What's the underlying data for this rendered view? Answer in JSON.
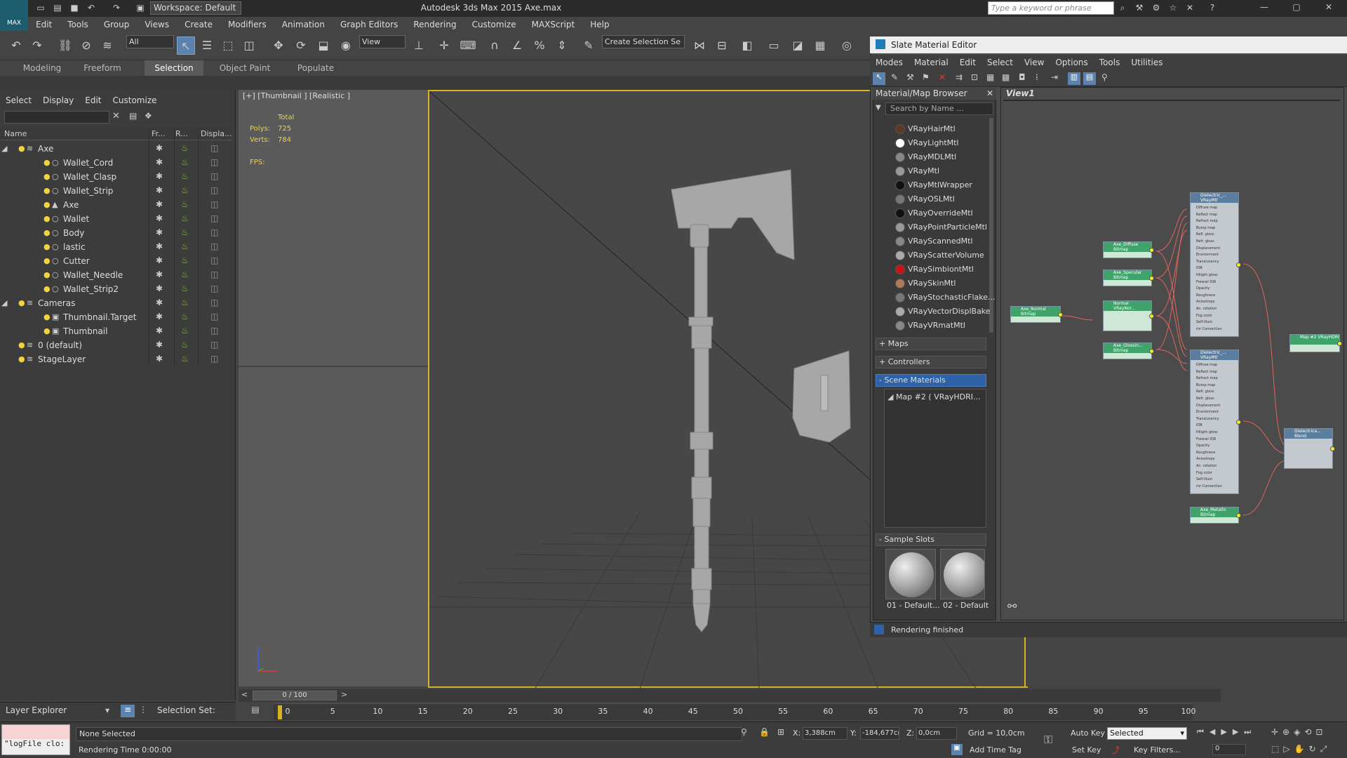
{
  "app": {
    "title": "Autodesk 3ds Max  2015     Axe.max",
    "workspace": "Workspace: Default",
    "search_placeholder": "Type a keyword or phrase",
    "logo_text": "MAX"
  },
  "menu": [
    "Edit",
    "Tools",
    "Group",
    "Views",
    "Create",
    "Modifiers",
    "Animation",
    "Graph Editors",
    "Rendering",
    "Customize",
    "MAXScript",
    "Help"
  ],
  "toolbar": {
    "filter": "All",
    "ref_coord": "View",
    "selection_set": "Create Selection Se"
  },
  "ribbon_tabs": [
    "Modeling",
    "Freeform",
    "Selection",
    "Object Paint",
    "Populate"
  ],
  "ribbon_active": "Selection",
  "scene_explorer": {
    "menu": [
      "Select",
      "Display",
      "Edit",
      "Customize"
    ],
    "columns": [
      "Name",
      "Fr...",
      "R...",
      "Displa..."
    ],
    "rows": [
      {
        "name": "Axe",
        "indent": 0,
        "type": "layer",
        "expand": true
      },
      {
        "name": "Wallet_Cord",
        "indent": 1,
        "type": "object"
      },
      {
        "name": "Wallet_Clasp",
        "indent": 1,
        "type": "object"
      },
      {
        "name": "Wallet_Strip",
        "indent": 1,
        "type": "object"
      },
      {
        "name": "Axe",
        "indent": 1,
        "type": "object2"
      },
      {
        "name": "Wallet",
        "indent": 1,
        "type": "object"
      },
      {
        "name": "Body",
        "indent": 1,
        "type": "object"
      },
      {
        "name": "lastic",
        "indent": 1,
        "type": "object"
      },
      {
        "name": "Cutter",
        "indent": 1,
        "type": "object"
      },
      {
        "name": "Wallet_Needle",
        "indent": 1,
        "type": "object"
      },
      {
        "name": "Wallet_Strip2",
        "indent": 1,
        "type": "object"
      },
      {
        "name": "Cameras",
        "indent": 0,
        "type": "layer",
        "expand": true
      },
      {
        "name": "Thumbnail.Target",
        "indent": 1,
        "type": "camera"
      },
      {
        "name": "Thumbnail",
        "indent": 1,
        "type": "camera"
      },
      {
        "name": "0 (default)",
        "indent": 0,
        "type": "layer"
      },
      {
        "name": "StageLayer",
        "indent": 0,
        "type": "layer"
      }
    ],
    "footer_label": "Layer Explorer",
    "selection_set_label": "Selection Set:"
  },
  "viewport": {
    "label": "[+] [Thumbnail ] [Realistic ]",
    "stats_total": "Total",
    "polys_label": "Polys:",
    "polys": "725",
    "verts_label": "Verts:",
    "verts": "784",
    "fps_label": "FPS:"
  },
  "timeline": {
    "frame": "0 / 100",
    "ticks": [
      "0",
      "5",
      "10",
      "15",
      "20",
      "25",
      "30",
      "35",
      "40",
      "45",
      "50",
      "55",
      "60",
      "65",
      "70",
      "75",
      "80",
      "85",
      "90",
      "95",
      "100"
    ]
  },
  "status": {
    "script_text": "\"logFile clo:",
    "selection": "None Selected",
    "rendering_time": "Rendering Time  0:00:00",
    "x_label": "X:",
    "x": "3,388cm",
    "y_label": "Y:",
    "y": "-184,677cr",
    "z_label": "Z:",
    "z": "0,0cm",
    "grid": "Grid = 10,0cm",
    "add_time_tag": "Add Time Tag",
    "auto_key": "Auto Key",
    "set_key": "Set Key",
    "key_mode": "Selected",
    "key_filters": "Key Filters...",
    "frame_field": "0"
  },
  "slate": {
    "title": "Slate Material Editor",
    "menu": [
      "Modes",
      "Material",
      "Edit",
      "Select",
      "View",
      "Options",
      "Tools",
      "Utilities"
    ],
    "browser_title": "Material/Map Browser",
    "browser_search": "Search by Name ...",
    "materials": [
      {
        "name": "VRayHairMtl",
        "color": "#5a3a22"
      },
      {
        "name": "VRayLightMtl",
        "color": "#ffffff"
      },
      {
        "name": "VRayMDLMtl",
        "color": "#888888"
      },
      {
        "name": "VRayMtl",
        "color": "#999999"
      },
      {
        "name": "VRayMtlWrapper",
        "color": "#111111"
      },
      {
        "name": "VRayOSLMtl",
        "color": "#777777"
      },
      {
        "name": "VRayOverrideMtl",
        "color": "#111111"
      },
      {
        "name": "VRayPointParticleMtl",
        "color": "#999999"
      },
      {
        "name": "VRayScannedMtl",
        "color": "#888888"
      },
      {
        "name": "VRayScatterVolume",
        "color": "#aaaaaa"
      },
      {
        "name": "VRaySimbiontMtl",
        "color": "#cc1111"
      },
      {
        "name": "VRaySkinMtl",
        "color": "#b07a5a"
      },
      {
        "name": "VRayStochasticFlake...",
        "color": "#777777"
      },
      {
        "name": "VRayVectorDisplBake",
        "color": "#aaaaaa"
      },
      {
        "name": "VRayVRmatMtl",
        "color": "#888888"
      }
    ],
    "sections": {
      "maps": "+ Maps",
      "controllers": "+ Controllers",
      "scene_materials": "- Scene Materials",
      "scene_item": "Map #2  ( VRayHDRI...",
      "sample_slots": "- Sample Slots"
    },
    "slots": [
      "01 - Default...",
      "02 - Default"
    ],
    "view_tab": "View1",
    "status": "Rendering finished",
    "nodes": {
      "dielectric_1": "Dielectric_... VRayMtl",
      "dielectric_2": "Dielectric_... VRayMtl",
      "blend": "Dielectrica... Blend",
      "diffuse": "Axe_Diffuse Bitmap",
      "specular": "Axe_Specular Bitmap",
      "normal": "Normal VRayNor...",
      "glossiness": "Axe_Glossin... Bitmap",
      "normal_map": "Axe_Normal Bitmap",
      "metallic": "Axe_Metallic Bitmap",
      "hdri": "Map #2 VRayHDRI"
    },
    "vray_slots": [
      "Diffuse map",
      "Reflect map",
      "Refract map",
      "Bump map",
      "Refl. gloss",
      "Refr. gloss",
      "Displacement",
      "Environment",
      "Translucency",
      "IOR",
      "Hilight gloss",
      "Fresnel IOR",
      "Opacity",
      "Roughness",
      "Anisotropy",
      "An. rotation",
      "Fog color",
      "Self-illum",
      "mr Connection"
    ]
  }
}
